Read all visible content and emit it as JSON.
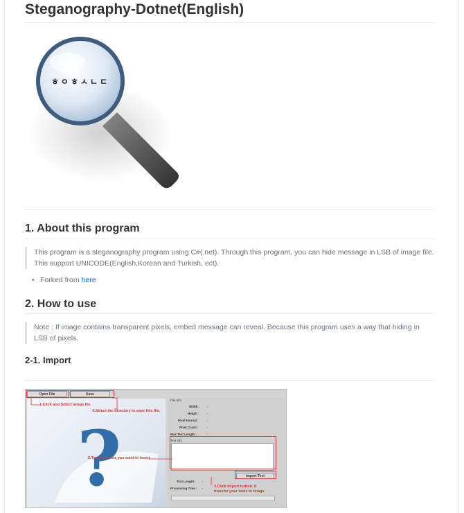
{
  "title": "Steganography-Dotnet(English)",
  "logo": {
    "text": "ㅎㅇㅎㅅㄴㄷ"
  },
  "section1": {
    "heading": "1. About this program",
    "description": "This program is a steganography program using C#(.net). Through this program, you can hide message in LSB of image file. This support UNICODE(English,Korean and Turkish, ect).",
    "bullet_prefix": "Forked from ",
    "bullet_link": "here"
  },
  "section2": {
    "heading": "2. How to use",
    "note": "Note : If image contains transparent pixels, embed message can reveal. Because this program uses a way that hiding in LSB of pixels."
  },
  "section21": {
    "heading": "2-1. Import"
  },
  "screenshot": {
    "open_file": "Open File",
    "save": "Save",
    "file_info": "File Info",
    "width": "Width :",
    "height": "Height :",
    "pixel_format": "Pixel Format :",
    "pixel_count": "Pixel Count :",
    "max_text_length": "Max Text Length :",
    "text_info": "Text Info",
    "import_text": "Import Text",
    "text_length": "Text Lenght :",
    "processing_time": "Processing Time :",
    "dash": "-",
    "ann1": "1.Click and Select image file.",
    "ann4": "4.Select the directory to save this file.",
    "ann2": "2.Type the texts you want to insert",
    "ann3a": "3.Click Import button. It",
    "ann3b": "transfer your texts to image."
  },
  "colors": {
    "accent": "#0366d6",
    "annotation": "#dd3333"
  }
}
